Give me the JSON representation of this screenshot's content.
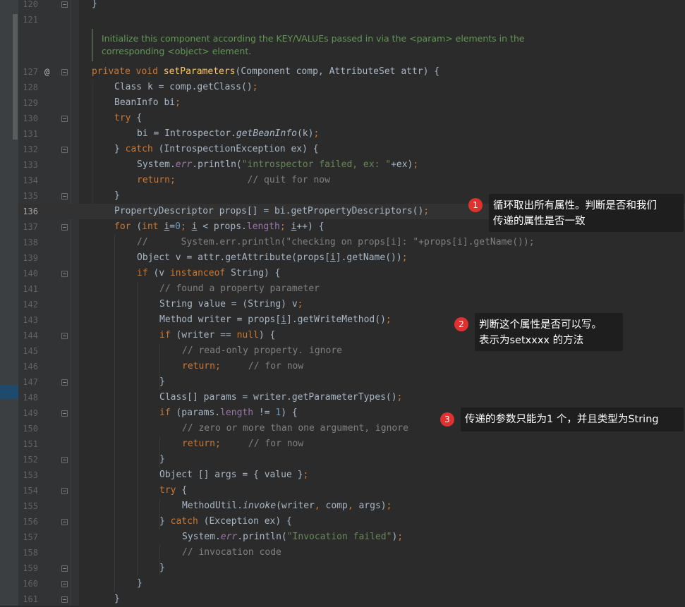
{
  "doc_comment": {
    "line1": "Initialize this component according the KEY/VALUEs passed in via the <param> elements in the",
    "line2": "corresponding <object> element."
  },
  "gutter_marker": "@",
  "callouts": [
    {
      "number": "1",
      "line1": "循环取出所有属性。判断是否和我们",
      "line2": "传递的属性是否一致"
    },
    {
      "number": "2",
      "line1": "判断这个属性是否可以写。",
      "line2": "表示为setxxxx 的方法"
    },
    {
      "number": "3",
      "line1": "传递的参数只能为1 个，并且类型为String"
    }
  ],
  "lines": [
    {
      "n": "120",
      "indent": 0,
      "segs": [
        [
          "",
          "}"
        ]
      ]
    },
    {
      "n": "121",
      "indent": 0,
      "segs": []
    },
    {
      "n": "127",
      "indent": 0,
      "segs": [
        [
          "kw",
          "private "
        ],
        [
          "kw",
          "void "
        ],
        [
          "fn",
          "setParameters"
        ],
        [
          "",
          "(Component comp, AttributeSet attr) {"
        ]
      ]
    },
    {
      "n": "128",
      "indent": 1,
      "segs": [
        [
          "",
          "Class k = comp.getClass()"
        ],
        [
          "kw",
          ";"
        ]
      ]
    },
    {
      "n": "129",
      "indent": 1,
      "segs": [
        [
          "",
          "BeanInfo bi"
        ],
        [
          "kw",
          ";"
        ]
      ]
    },
    {
      "n": "130",
      "indent": 1,
      "segs": [
        [
          "kw",
          "try "
        ],
        [
          "",
          "{"
        ]
      ]
    },
    {
      "n": "131",
      "indent": 2,
      "segs": [
        [
          "",
          "bi = Introspector."
        ],
        [
          "it",
          "getBeanInfo"
        ],
        [
          "",
          "(k)"
        ],
        [
          "kw",
          ";"
        ]
      ]
    },
    {
      "n": "132",
      "indent": 1,
      "segs": [
        [
          "",
          "} "
        ],
        [
          "kw",
          "catch "
        ],
        [
          "",
          "(IntrospectionException ex) {"
        ]
      ]
    },
    {
      "n": "133",
      "indent": 2,
      "segs": [
        [
          "",
          "System."
        ],
        [
          "fld it",
          "err"
        ],
        [
          "",
          ".println("
        ],
        [
          "str",
          "\"introspector failed, ex: \""
        ],
        [
          "",
          "+ex)"
        ],
        [
          "kw",
          ";"
        ]
      ]
    },
    {
      "n": "134",
      "indent": 2,
      "segs": [
        [
          "kw",
          "return;"
        ],
        [
          "cm",
          "             // quit for now"
        ]
      ]
    },
    {
      "n": "135",
      "indent": 1,
      "segs": [
        [
          "",
          "}"
        ]
      ]
    },
    {
      "n": "136",
      "indent": 1,
      "segs": [
        [
          "",
          "PropertyDescriptor props[] = bi.getPropertyDescriptors()"
        ],
        [
          "kw",
          ";"
        ]
      ]
    },
    {
      "n": "137",
      "indent": 1,
      "segs": [
        [
          "kw",
          "for "
        ],
        [
          "",
          "("
        ],
        [
          "kw",
          "int "
        ],
        [
          "ul",
          "i"
        ],
        [
          "",
          "="
        ],
        [
          "num",
          "0"
        ],
        [
          "kw",
          "; "
        ],
        [
          "ul",
          "i"
        ],
        [
          "",
          " < props."
        ],
        [
          "fld",
          "length"
        ],
        [
          "kw",
          "; "
        ],
        [
          "ul",
          "i"
        ],
        [
          "",
          "++) {"
        ]
      ]
    },
    {
      "n": "138",
      "indent": 2,
      "segs": [
        [
          "cm",
          "//      System.err.println(\"checking on props[i]: \"+props[i].getName());"
        ]
      ]
    },
    {
      "n": "139",
      "indent": 2,
      "segs": [
        [
          "",
          "Object v = attr.getAttribute(props["
        ],
        [
          "ul",
          "i"
        ],
        [
          "",
          "].getName())"
        ],
        [
          "kw",
          ";"
        ]
      ]
    },
    {
      "n": "140",
      "indent": 2,
      "segs": [
        [
          "kw",
          "if "
        ],
        [
          "",
          "(v "
        ],
        [
          "kw",
          "instanceof "
        ],
        [
          "",
          "String) {"
        ]
      ]
    },
    {
      "n": "141",
      "indent": 3,
      "segs": [
        [
          "cm",
          "// found a property parameter"
        ]
      ]
    },
    {
      "n": "142",
      "indent": 3,
      "segs": [
        [
          "",
          "String value = (String) v"
        ],
        [
          "kw",
          ";"
        ]
      ]
    },
    {
      "n": "143",
      "indent": 3,
      "segs": [
        [
          "",
          "Method writer = props["
        ],
        [
          "ul",
          "i"
        ],
        [
          "",
          "].getWriteMethod()"
        ],
        [
          "kw",
          ";"
        ]
      ]
    },
    {
      "n": "144",
      "indent": 3,
      "segs": [
        [
          "kw",
          "if "
        ],
        [
          "",
          "(writer == "
        ],
        [
          "kw",
          "null"
        ],
        [
          "",
          ") {"
        ]
      ]
    },
    {
      "n": "145",
      "indent": 4,
      "segs": [
        [
          "cm",
          "// read-only property. ignore"
        ]
      ]
    },
    {
      "n": "146",
      "indent": 4,
      "segs": [
        [
          "kw",
          "return;"
        ],
        [
          "cm",
          "     // for now"
        ]
      ]
    },
    {
      "n": "147",
      "indent": 3,
      "segs": [
        [
          "",
          "}"
        ]
      ]
    },
    {
      "n": "148",
      "indent": 3,
      "segs": [
        [
          "",
          "Class[] params = writer.getParameterTypes()"
        ],
        [
          "kw",
          ";"
        ]
      ]
    },
    {
      "n": "149",
      "indent": 3,
      "segs": [
        [
          "kw",
          "if "
        ],
        [
          "",
          "(params."
        ],
        [
          "fld",
          "length "
        ],
        [
          "",
          "!= "
        ],
        [
          "num",
          "1"
        ],
        [
          "",
          ") {"
        ]
      ]
    },
    {
      "n": "150",
      "indent": 4,
      "segs": [
        [
          "cm",
          "// zero or more than one argument, ignore"
        ]
      ]
    },
    {
      "n": "151",
      "indent": 4,
      "segs": [
        [
          "kw",
          "return;"
        ],
        [
          "cm",
          "     // for now"
        ]
      ]
    },
    {
      "n": "152",
      "indent": 3,
      "segs": [
        [
          "",
          "}"
        ]
      ]
    },
    {
      "n": "153",
      "indent": 3,
      "segs": [
        [
          "",
          "Object [] args = { value }"
        ],
        [
          "kw",
          ";"
        ]
      ]
    },
    {
      "n": "154",
      "indent": 3,
      "segs": [
        [
          "kw",
          "try "
        ],
        [
          "",
          "{"
        ]
      ]
    },
    {
      "n": "155",
      "indent": 4,
      "segs": [
        [
          "",
          "MethodUtil."
        ],
        [
          "it",
          "invoke"
        ],
        [
          "",
          "(writer"
        ],
        [
          "kw",
          ", "
        ],
        [
          "",
          "comp"
        ],
        [
          "kw",
          ", "
        ],
        [
          "",
          "args)"
        ],
        [
          "kw",
          ";"
        ]
      ]
    },
    {
      "n": "156",
      "indent": 3,
      "segs": [
        [
          "",
          "} "
        ],
        [
          "kw",
          "catch "
        ],
        [
          "",
          "(Exception ex) {"
        ]
      ]
    },
    {
      "n": "157",
      "indent": 4,
      "segs": [
        [
          "",
          "System."
        ],
        [
          "fld it",
          "err"
        ],
        [
          "",
          ".println("
        ],
        [
          "str",
          "\"Invocation failed\""
        ],
        [
          "",
          ")"
        ],
        [
          "kw",
          ";"
        ]
      ]
    },
    {
      "n": "158",
      "indent": 4,
      "segs": [
        [
          "cm",
          "// invocation code"
        ]
      ]
    },
    {
      "n": "159",
      "indent": 3,
      "segs": [
        [
          "",
          "}"
        ]
      ]
    },
    {
      "n": "160",
      "indent": 2,
      "segs": [
        [
          "",
          "}"
        ]
      ]
    },
    {
      "n": "161",
      "indent": 1,
      "segs": [
        [
          "",
          "}"
        ]
      ]
    }
  ]
}
